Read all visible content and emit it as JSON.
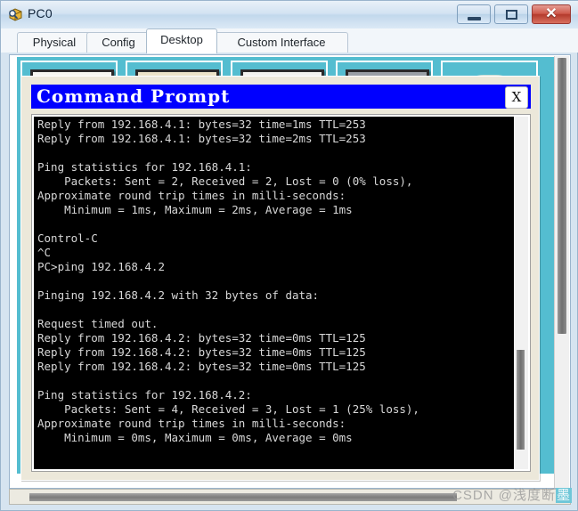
{
  "window": {
    "title": "PC0",
    "icon": "packet-tracer-device-icon",
    "controls": {
      "minimize": "–",
      "maximize": "□",
      "close": "✕"
    }
  },
  "tabs": [
    {
      "label": "Physical",
      "active": false
    },
    {
      "label": "Config",
      "active": false
    },
    {
      "label": "Desktop",
      "active": true
    },
    {
      "label": "Custom Interface",
      "active": false
    }
  ],
  "desktop": {
    "icons": [
      {
        "name": "desktop-icon-1"
      },
      {
        "name": "desktop-icon-2"
      },
      {
        "name": "desktop-icon-3"
      },
      {
        "name": "desktop-icon-4"
      },
      {
        "name": "desktop-icon-5"
      }
    ]
  },
  "command_prompt": {
    "title": "Command Prompt",
    "close_label": "X",
    "prompt": "PC>",
    "lines": [
      "Reply from 192.168.4.1: bytes=32 time=1ms TTL=253",
      "Reply from 192.168.4.1: bytes=32 time=2ms TTL=253",
      "",
      "Ping statistics for 192.168.4.1:",
      "    Packets: Sent = 2, Received = 2, Lost = 0 (0% loss),",
      "Approximate round trip times in milli-seconds:",
      "    Minimum = 1ms, Maximum = 2ms, Average = 1ms",
      "",
      "Control-C",
      "^C",
      "PC>ping 192.168.4.2",
      "",
      "Pinging 192.168.4.2 with 32 bytes of data:",
      "",
      "Request timed out.",
      "Reply from 192.168.4.2: bytes=32 time=0ms TTL=125",
      "Reply from 192.168.4.2: bytes=32 time=0ms TTL=125",
      "Reply from 192.168.4.2: bytes=32 time=0ms TTL=125",
      "",
      "Ping statistics for 192.168.4.2:",
      "    Packets: Sent = 4, Received = 3, Lost = 1 (25% loss),",
      "Approximate round trip times in milli-seconds:",
      "    Minimum = 0ms, Maximum = 0ms, Average = 0ms",
      "",
      ""
    ]
  },
  "watermark": {
    "prefix": "CSDN @浅度断",
    "highlight": "墨"
  },
  "colors": {
    "title_blue": "#0000ff",
    "dialog_beige": "#ece8da",
    "desktop_teal": "#54bdd0",
    "terminal_bg": "#000000",
    "terminal_fg": "#d8d8d8",
    "close_red": "#b33a2c"
  }
}
